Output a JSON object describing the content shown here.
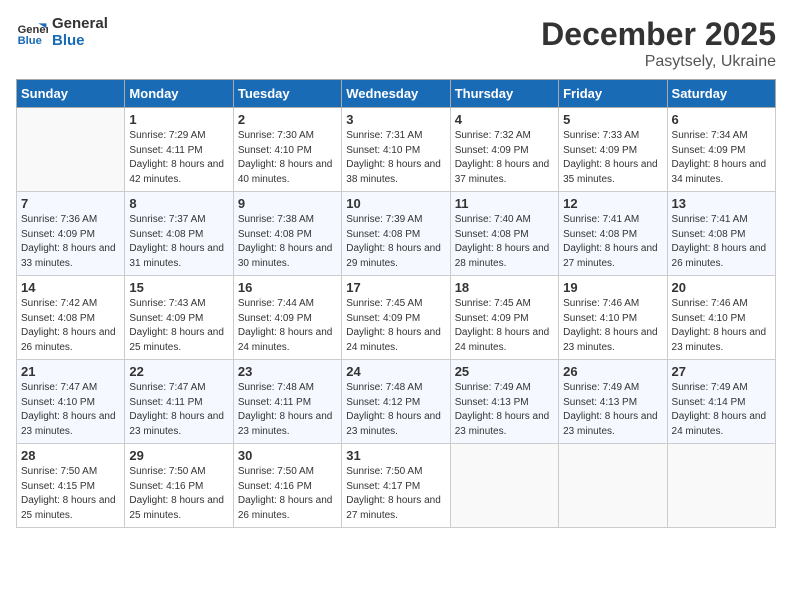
{
  "header": {
    "logo_line1": "General",
    "logo_line2": "Blue",
    "month": "December 2025",
    "location": "Pasytsely, Ukraine"
  },
  "weekdays": [
    "Sunday",
    "Monday",
    "Tuesday",
    "Wednesday",
    "Thursday",
    "Friday",
    "Saturday"
  ],
  "weeks": [
    [
      {
        "day": "",
        "sunrise": "",
        "sunset": "",
        "daylight": ""
      },
      {
        "day": "1",
        "sunrise": "Sunrise: 7:29 AM",
        "sunset": "Sunset: 4:11 PM",
        "daylight": "Daylight: 8 hours and 42 minutes."
      },
      {
        "day": "2",
        "sunrise": "Sunrise: 7:30 AM",
        "sunset": "Sunset: 4:10 PM",
        "daylight": "Daylight: 8 hours and 40 minutes."
      },
      {
        "day": "3",
        "sunrise": "Sunrise: 7:31 AM",
        "sunset": "Sunset: 4:10 PM",
        "daylight": "Daylight: 8 hours and 38 minutes."
      },
      {
        "day": "4",
        "sunrise": "Sunrise: 7:32 AM",
        "sunset": "Sunset: 4:09 PM",
        "daylight": "Daylight: 8 hours and 37 minutes."
      },
      {
        "day": "5",
        "sunrise": "Sunrise: 7:33 AM",
        "sunset": "Sunset: 4:09 PM",
        "daylight": "Daylight: 8 hours and 35 minutes."
      },
      {
        "day": "6",
        "sunrise": "Sunrise: 7:34 AM",
        "sunset": "Sunset: 4:09 PM",
        "daylight": "Daylight: 8 hours and 34 minutes."
      }
    ],
    [
      {
        "day": "7",
        "sunrise": "Sunrise: 7:36 AM",
        "sunset": "Sunset: 4:09 PM",
        "daylight": "Daylight: 8 hours and 33 minutes."
      },
      {
        "day": "8",
        "sunrise": "Sunrise: 7:37 AM",
        "sunset": "Sunset: 4:08 PM",
        "daylight": "Daylight: 8 hours and 31 minutes."
      },
      {
        "day": "9",
        "sunrise": "Sunrise: 7:38 AM",
        "sunset": "Sunset: 4:08 PM",
        "daylight": "Daylight: 8 hours and 30 minutes."
      },
      {
        "day": "10",
        "sunrise": "Sunrise: 7:39 AM",
        "sunset": "Sunset: 4:08 PM",
        "daylight": "Daylight: 8 hours and 29 minutes."
      },
      {
        "day": "11",
        "sunrise": "Sunrise: 7:40 AM",
        "sunset": "Sunset: 4:08 PM",
        "daylight": "Daylight: 8 hours and 28 minutes."
      },
      {
        "day": "12",
        "sunrise": "Sunrise: 7:41 AM",
        "sunset": "Sunset: 4:08 PM",
        "daylight": "Daylight: 8 hours and 27 minutes."
      },
      {
        "day": "13",
        "sunrise": "Sunrise: 7:41 AM",
        "sunset": "Sunset: 4:08 PM",
        "daylight": "Daylight: 8 hours and 26 minutes."
      }
    ],
    [
      {
        "day": "14",
        "sunrise": "Sunrise: 7:42 AM",
        "sunset": "Sunset: 4:08 PM",
        "daylight": "Daylight: 8 hours and 26 minutes."
      },
      {
        "day": "15",
        "sunrise": "Sunrise: 7:43 AM",
        "sunset": "Sunset: 4:09 PM",
        "daylight": "Daylight: 8 hours and 25 minutes."
      },
      {
        "day": "16",
        "sunrise": "Sunrise: 7:44 AM",
        "sunset": "Sunset: 4:09 PM",
        "daylight": "Daylight: 8 hours and 24 minutes."
      },
      {
        "day": "17",
        "sunrise": "Sunrise: 7:45 AM",
        "sunset": "Sunset: 4:09 PM",
        "daylight": "Daylight: 8 hours and 24 minutes."
      },
      {
        "day": "18",
        "sunrise": "Sunrise: 7:45 AM",
        "sunset": "Sunset: 4:09 PM",
        "daylight": "Daylight: 8 hours and 24 minutes."
      },
      {
        "day": "19",
        "sunrise": "Sunrise: 7:46 AM",
        "sunset": "Sunset: 4:10 PM",
        "daylight": "Daylight: 8 hours and 23 minutes."
      },
      {
        "day": "20",
        "sunrise": "Sunrise: 7:46 AM",
        "sunset": "Sunset: 4:10 PM",
        "daylight": "Daylight: 8 hours and 23 minutes."
      }
    ],
    [
      {
        "day": "21",
        "sunrise": "Sunrise: 7:47 AM",
        "sunset": "Sunset: 4:10 PM",
        "daylight": "Daylight: 8 hours and 23 minutes."
      },
      {
        "day": "22",
        "sunrise": "Sunrise: 7:47 AM",
        "sunset": "Sunset: 4:11 PM",
        "daylight": "Daylight: 8 hours and 23 minutes."
      },
      {
        "day": "23",
        "sunrise": "Sunrise: 7:48 AM",
        "sunset": "Sunset: 4:11 PM",
        "daylight": "Daylight: 8 hours and 23 minutes."
      },
      {
        "day": "24",
        "sunrise": "Sunrise: 7:48 AM",
        "sunset": "Sunset: 4:12 PM",
        "daylight": "Daylight: 8 hours and 23 minutes."
      },
      {
        "day": "25",
        "sunrise": "Sunrise: 7:49 AM",
        "sunset": "Sunset: 4:13 PM",
        "daylight": "Daylight: 8 hours and 23 minutes."
      },
      {
        "day": "26",
        "sunrise": "Sunrise: 7:49 AM",
        "sunset": "Sunset: 4:13 PM",
        "daylight": "Daylight: 8 hours and 23 minutes."
      },
      {
        "day": "27",
        "sunrise": "Sunrise: 7:49 AM",
        "sunset": "Sunset: 4:14 PM",
        "daylight": "Daylight: 8 hours and 24 minutes."
      }
    ],
    [
      {
        "day": "28",
        "sunrise": "Sunrise: 7:50 AM",
        "sunset": "Sunset: 4:15 PM",
        "daylight": "Daylight: 8 hours and 25 minutes."
      },
      {
        "day": "29",
        "sunrise": "Sunrise: 7:50 AM",
        "sunset": "Sunset: 4:16 PM",
        "daylight": "Daylight: 8 hours and 25 minutes."
      },
      {
        "day": "30",
        "sunrise": "Sunrise: 7:50 AM",
        "sunset": "Sunset: 4:16 PM",
        "daylight": "Daylight: 8 hours and 26 minutes."
      },
      {
        "day": "31",
        "sunrise": "Sunrise: 7:50 AM",
        "sunset": "Sunset: 4:17 PM",
        "daylight": "Daylight: 8 hours and 27 minutes."
      },
      {
        "day": "",
        "sunrise": "",
        "sunset": "",
        "daylight": ""
      },
      {
        "day": "",
        "sunrise": "",
        "sunset": "",
        "daylight": ""
      },
      {
        "day": "",
        "sunrise": "",
        "sunset": "",
        "daylight": ""
      }
    ]
  ]
}
